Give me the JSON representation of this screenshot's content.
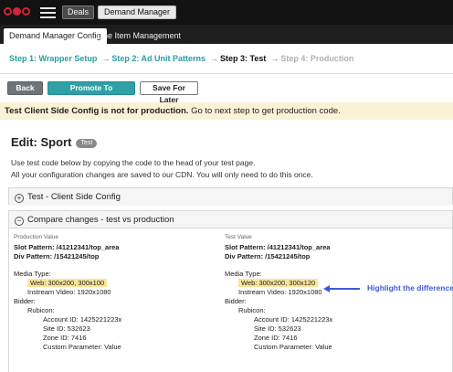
{
  "topbar": {
    "nav_deals": "Deals",
    "nav_demand_manager": "Demand Manager"
  },
  "tabs": [
    {
      "label": "Demand Manager Config"
    },
    {
      "label": "Line Item Management"
    }
  ],
  "steps": [
    {
      "label": "Step 1: Wrapper Setup",
      "state": "done"
    },
    {
      "label": "Step 2: Ad Unit Patterns",
      "state": "done"
    },
    {
      "label": "Step 3: Test",
      "state": "current"
    },
    {
      "label": "Step 4: Production",
      "state": "future"
    }
  ],
  "actions": {
    "back": "Back",
    "promote": "Promote To Production",
    "save_later": "Save For Later"
  },
  "notice": {
    "bold": "Test Client Side Config is not for production.",
    "rest": " Go to next step to get production code."
  },
  "edit": {
    "title": "Edit: Sport",
    "badge": "Test",
    "desc1": "Use test code below by copying the code to the head of your test page.",
    "desc2": "All your configuration changes are saved to our CDN. You will only need to do this once."
  },
  "panels": {
    "client_config": "Test - Client Side Config",
    "compare": "Compare changes - test vs production"
  },
  "production": {
    "caption": "Production Value",
    "slot_pattern": "Slot Pattern: /41212341/top_area",
    "div_pattern": "Div Pattern: /15421245/top",
    "media_type": "Media Type:",
    "web": "Web: 300x200, 300x100",
    "instream": "Instream Video: 1920x1080",
    "bidder": "Bidder:",
    "rubicon": "Rubicon:",
    "account": "Account ID: 1425221223x",
    "site": "Site ID: 532623",
    "zone": "Zone ID: 7416",
    "custom": "Custom Parameter: Value"
  },
  "test": {
    "caption": "Test Value",
    "slot_pattern": "Slot Pattern: /41212341/top_area",
    "div_pattern": "Div Pattern: /15421245/top",
    "media_type": "Media Type:",
    "web": "Web: 300x200, 300x120",
    "instream": "Instream Video: 1920x1080",
    "bidder": "Bidder:",
    "rubicon": "Rubicon:",
    "account": "Account ID: 1425221223x",
    "site": "Site ID: 532623",
    "zone": "Zone ID: 7416",
    "custom": "Custom Parameter: Value"
  },
  "callout": {
    "text": "Highlight the differences",
    "color": "#3e5bd9"
  },
  "colors": {
    "accent": "#2ea1a6",
    "highlight": "#fbe49a",
    "notice_bg": "#fbf2d6",
    "logo": "#d0243a"
  }
}
